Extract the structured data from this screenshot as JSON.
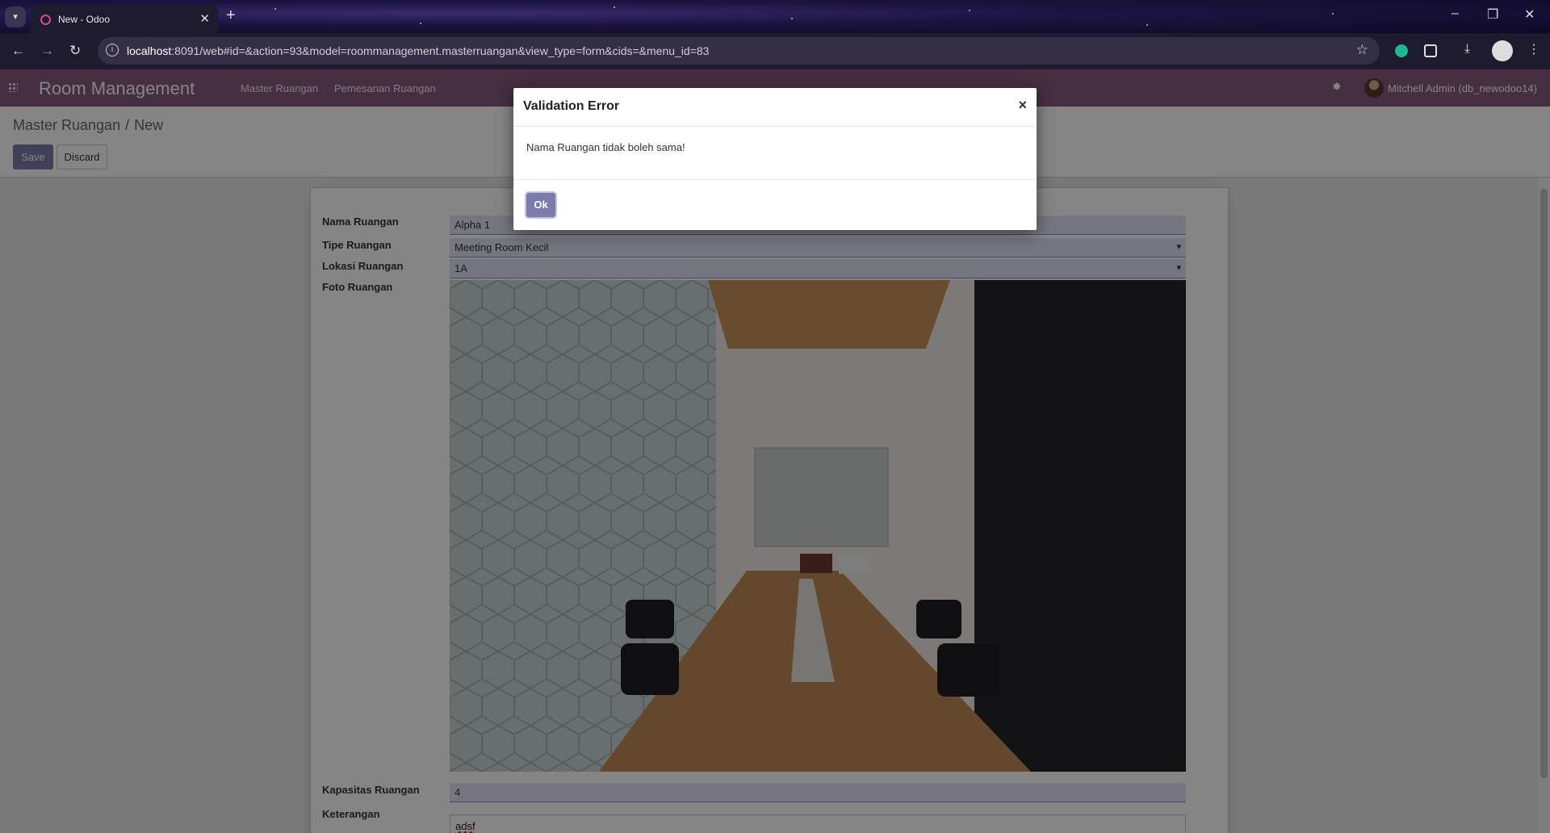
{
  "browser": {
    "tab_title": "New - Odoo",
    "url_host": "localhost",
    "url_path": ":8091/web#id=&action=93&model=roommanagement.masterruangan&view_type=form&cids=&menu_id=83"
  },
  "app": {
    "brand": "Room Management",
    "menu": [
      "Master Ruangan",
      "Pemesanan Ruangan"
    ],
    "user": "Mitchell Admin (db_newodoo14)",
    "accent_color": "#875a7b",
    "button_color": "#7c7bad"
  },
  "breadcrumb": {
    "parent": "Master Ruangan",
    "separator": "/",
    "current": "New"
  },
  "actions": {
    "save": "Save",
    "discard": "Discard"
  },
  "form": {
    "nama_ruangan_label": "Nama Ruangan",
    "nama_ruangan_value": "Alpha 1",
    "tipe_ruangan_label": "Tipe Ruangan",
    "tipe_ruangan_value": "Meeting Room Kecil",
    "lokasi_ruangan_label": "Lokasi Ruangan",
    "lokasi_ruangan_value": "1A",
    "foto_ruangan_label": "Foto Ruangan",
    "kapasitas_ruangan_label": "Kapasitas Ruangan",
    "kapasitas_ruangan_value": "4",
    "keterangan_label": "Keterangan",
    "keterangan_value": "adsf"
  },
  "dialog": {
    "title": "Validation Error",
    "close": "×",
    "message": "Nama Ruangan tidak boleh sama!",
    "ok": "Ok"
  },
  "icons": {
    "caret": "▾",
    "close_tab": "✕",
    "new_tab": "+",
    "back": "←",
    "forward": "→",
    "reload": "↻",
    "bookmark": "☆",
    "minimize": "–",
    "restore": "❐",
    "close_window": "✕",
    "bug": "✸"
  }
}
